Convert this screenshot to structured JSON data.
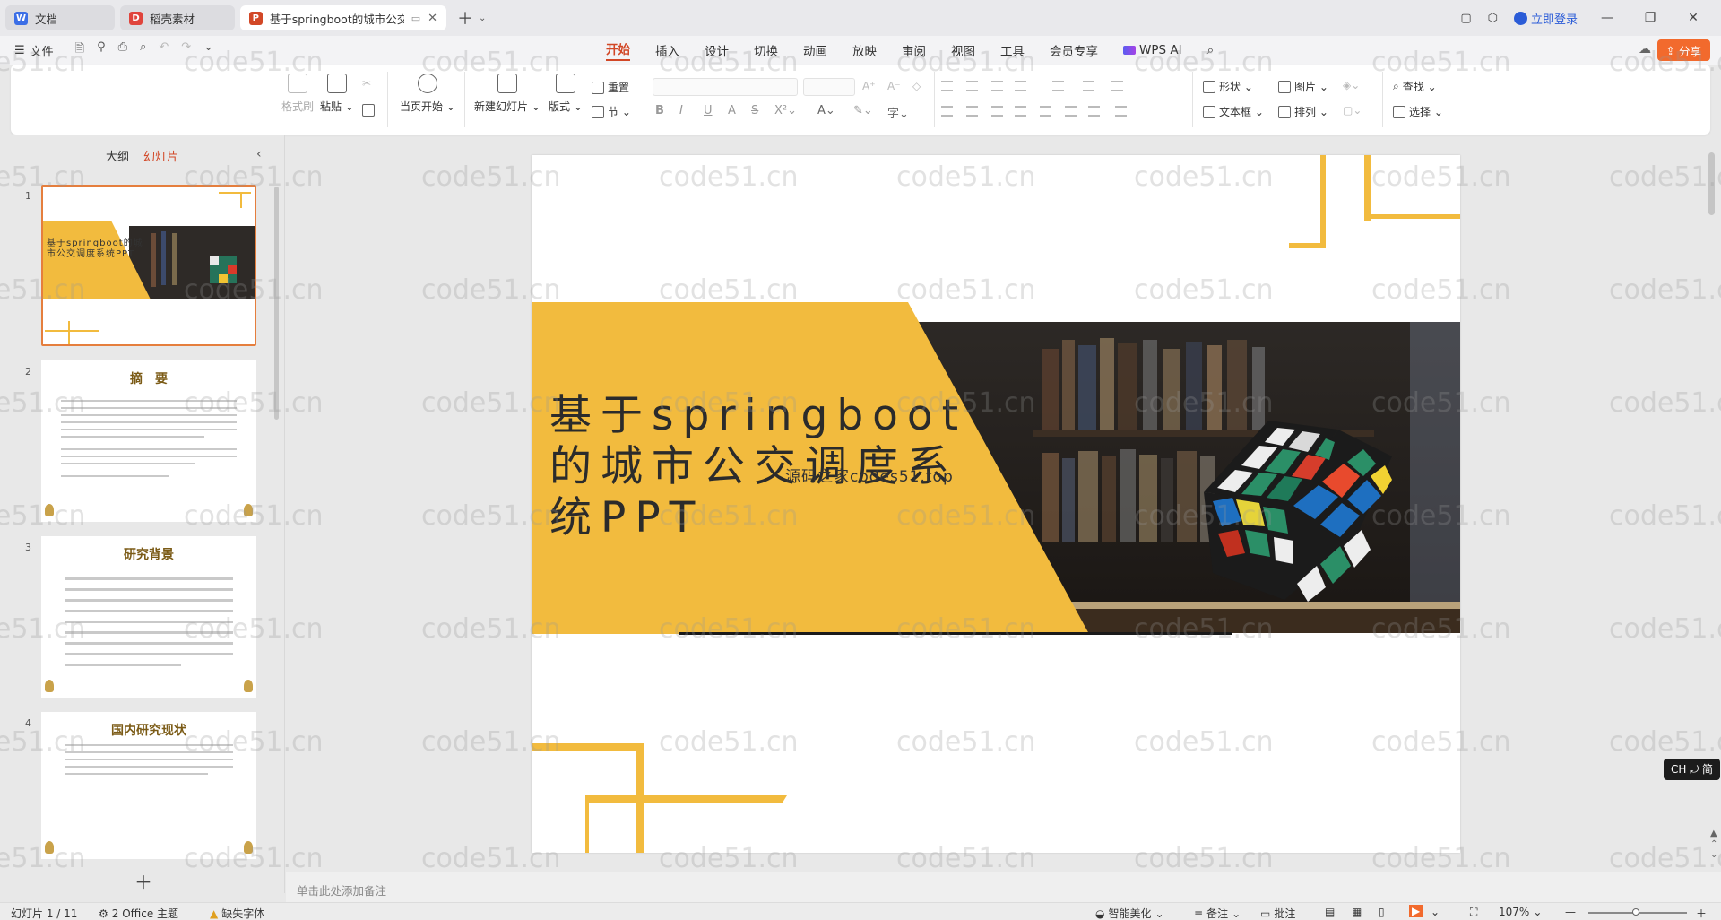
{
  "tabs": [
    {
      "label": "文档",
      "color": "#3b6ee6",
      "glyph": "W"
    },
    {
      "label": "稻壳素材",
      "color": "#e0443c",
      "glyph": "D"
    },
    {
      "label": "基于springboot的城市公交",
      "color": "#d24726",
      "glyph": "P",
      "active": true
    }
  ],
  "titlebar": {
    "login": "立即登录"
  },
  "menu": {
    "file": "文件",
    "items": [
      "开始",
      "插入",
      "设计",
      "切换",
      "动画",
      "放映",
      "审阅",
      "视图",
      "工具",
      "会员专享"
    ],
    "active": "开始",
    "wps_ai": "WPS AI",
    "share": "分享"
  },
  "ribbon": {
    "format_painter": "格式刷",
    "paste": "粘贴",
    "from_current": "当页开始",
    "new_slide": "新建幻灯片",
    "layout": "版式",
    "reset": "重置",
    "section": "节",
    "shape": "形状",
    "picture": "图片",
    "textbox": "文本框",
    "arrange": "排列",
    "find": "查找",
    "select": "选择"
  },
  "left_panel": {
    "tab_outline": "大纲",
    "tab_slides": "幻灯片",
    "slides": [
      {
        "num": "1",
        "title": "基于springboot的城市公交调度系统PPT"
      },
      {
        "num": "2",
        "title": "摘　要"
      },
      {
        "num": "3",
        "title": "研究背景"
      },
      {
        "num": "4",
        "title": "国内研究现状"
      }
    ]
  },
  "slide": {
    "title": "基于springboot的城市公交调度系统PPT",
    "subtitle": "源码之家codes51.top"
  },
  "notes_placeholder": "单击此处添加备注",
  "input_badge": "CH ⤾ 简",
  "status": {
    "slide_counter": "幻灯片 1 / 11",
    "theme": "2 Office 主题",
    "missing_font": "缺失字体",
    "beautify": "智能美化",
    "notes": "备注",
    "comments": "批注",
    "zoom": "107%"
  },
  "watermark": "code51.cn",
  "colors": {
    "accent": "#d24726",
    "slide_yellow": "#f2bb3e",
    "share": "#f26a2d"
  }
}
